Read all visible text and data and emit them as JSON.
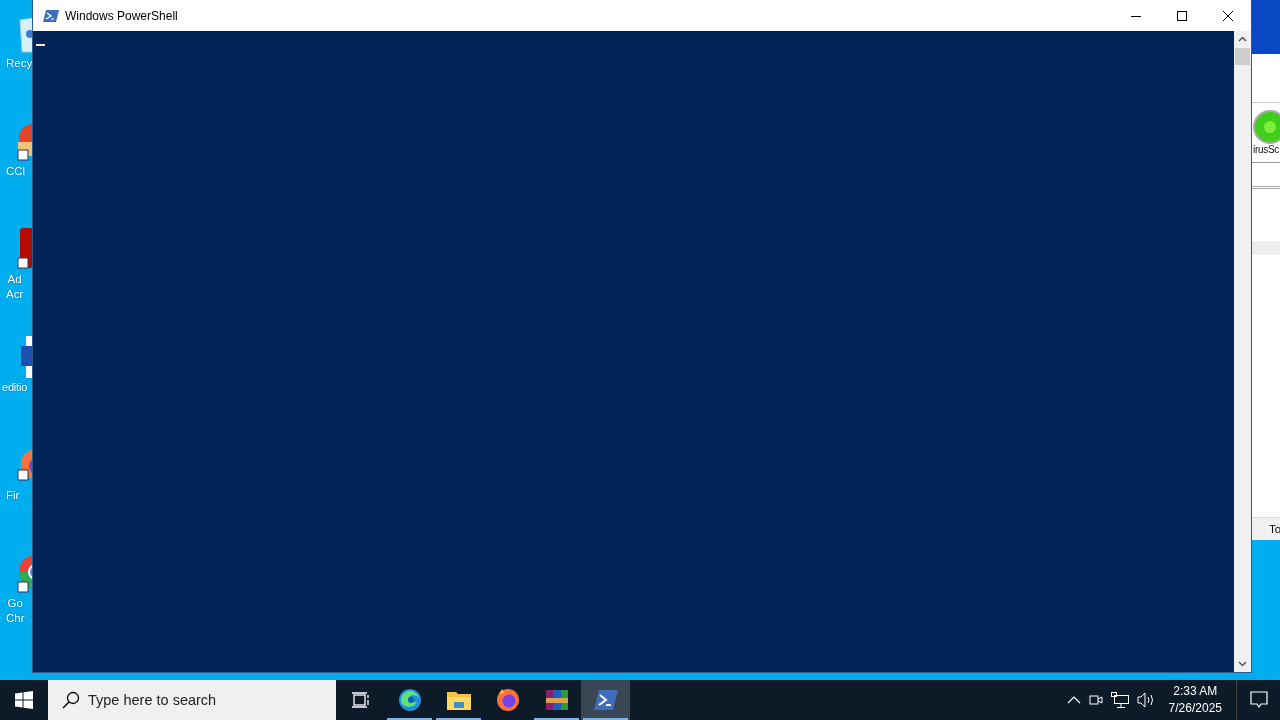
{
  "desktop_icons": [
    {
      "kind": "recycle",
      "lines": [
        "Recy"
      ]
    },
    {
      "kind": "cleaner",
      "lines": [
        "CCl"
      ]
    },
    {
      "kind": "acrobat",
      "lines": [
        "Ad",
        "Acr"
      ]
    },
    {
      "kind": "word",
      "lines": [
        "editio"
      ]
    },
    {
      "kind": "firefox",
      "lines": [
        "Fir"
      ]
    },
    {
      "kind": "chrome",
      "lines": [
        "Go",
        "Chr"
      ]
    }
  ],
  "background_window": {
    "item_label": "irusSc",
    "column_header": "To"
  },
  "window": {
    "title": "Windows PowerShell"
  },
  "taskbar": {
    "search": {
      "placeholder": "Type here to search"
    },
    "apps": [
      {
        "kind": "edge",
        "running": true,
        "selected": false
      },
      {
        "kind": "explorer",
        "running": true,
        "selected": false
      },
      {
        "kind": "firefox",
        "running": false,
        "selected": false
      },
      {
        "kind": "winrar",
        "running": true,
        "selected": false
      },
      {
        "kind": "powershell",
        "running": true,
        "selected": true
      }
    ],
    "clock": {
      "time": "2:33 AM",
      "date": "7/26/2025"
    }
  }
}
